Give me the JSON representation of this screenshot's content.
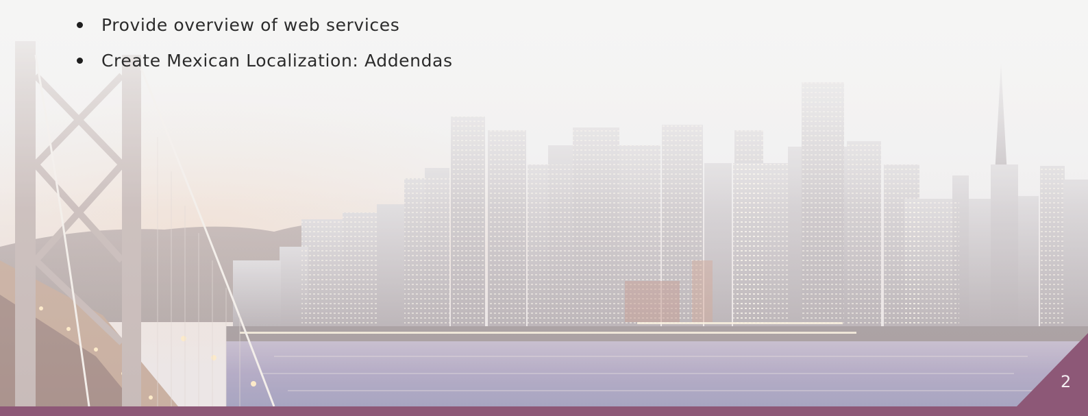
{
  "slide": {
    "bullets": [
      {
        "label": "Provide overview of web services"
      },
      {
        "label": "Create Mexican Localization: Addendas"
      }
    ],
    "page_number": "2"
  },
  "colors": {
    "accent": "#8d5877",
    "text": "#2b2b2b",
    "page_number": "#f4eef2",
    "sky": "#f2f2f1"
  },
  "icons": {
    "bullet": "filled-circle",
    "background": "san-francisco-skyline-photo"
  }
}
